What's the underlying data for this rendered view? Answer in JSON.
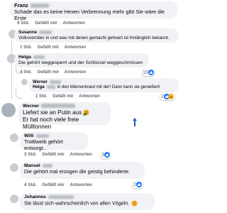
{
  "colors": {
    "bubble": "#f0f2f5",
    "meta": "#65676b",
    "like": "#1877f2",
    "love": "#f33e58",
    "haha": "#f7b125",
    "arrow": "#1d5bbf"
  },
  "comments": [
    {
      "name": "Franz",
      "text": "Schade das es keine Hexen Verbrennung mehr gibt Sie wäre die Erste",
      "age": "4 Std.",
      "like": "Gefällt mir",
      "reply": "Antworten"
    },
    {
      "name": "Susanne",
      "text": "Volksverräter in und was mit denen gemacht gehoert ist hinlänglich bekannt.",
      "age": "1 Std.",
      "like": "Gefällt mir",
      "reply": "Antworten"
    },
    {
      "name": "Helga",
      "text": "Die gehört weggesperrt und der Schlüssel weggeschmissen",
      "age": "4 Std.",
      "like": "Gefällt mir",
      "reply": "Antworten",
      "reactions": "10"
    },
    {
      "name": "Werner",
      "text_a": "Helga",
      "text_b": "in den Männerknast mit der! Dann kann sie genießen!",
      "age": "1 Std.",
      "like": "Gefällt mir",
      "reply": "Antworten",
      "reactions": "2"
    },
    {
      "name": "Werner",
      "line1": "Liefert sie an Putin aus",
      "line2": "Er hat noch viele freie Mülltonnen",
      "emoji": "angry-laugh-icon"
    },
    {
      "name": "Willi",
      "text": "Trottlweib gehört entsorgt..",
      "age": "3 Std.",
      "like": "Gefällt mir",
      "reply": "Antworten",
      "reactions": "3"
    },
    {
      "name": "Manuel",
      "text": "Die gehört mal erzogen die geistig behinderte.",
      "age": "4 Std.",
      "like": "Gefällt mir",
      "reply": "Antworten",
      "reactions": "2"
    },
    {
      "name": "Johannes",
      "text": "Sie lässt sich wahrscheinlich von allen Vögeln.",
      "emoji": "grinning-icon"
    }
  ]
}
